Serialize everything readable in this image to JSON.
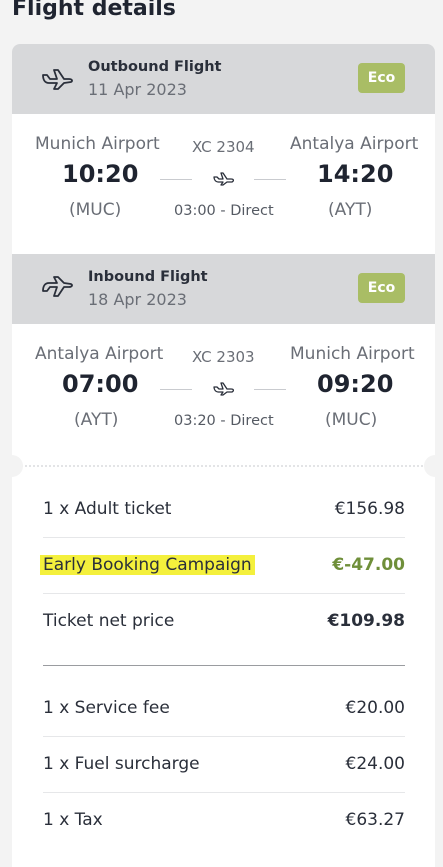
{
  "page_title": "Flight details",
  "outbound": {
    "title": "Outbound Flight",
    "date": "11 Apr 2023",
    "fare_class": "Eco",
    "from_airport": "Munich Airport",
    "to_airport": "Antalya Airport",
    "flight_number": "XC 2304",
    "departure_time": "10:20",
    "arrival_time": "14:20",
    "from_code": "(MUC)",
    "to_code": "(AYT)",
    "duration": "03:00 - Direct"
  },
  "inbound": {
    "title": "Inbound Flight",
    "date": "18 Apr 2023",
    "fare_class": "Eco",
    "from_airport": "Antalya Airport",
    "to_airport": "Munich Airport",
    "flight_number": "XC 2303",
    "departure_time": "07:00",
    "arrival_time": "09:20",
    "from_code": "(AYT)",
    "to_code": "(MUC)",
    "duration": "03:20 - Direct"
  },
  "prices": {
    "adult_ticket": {
      "label": "1 x Adult ticket",
      "amount": "€156.98"
    },
    "campaign": {
      "label": "Early Booking Campaign",
      "amount": "€-47.00"
    },
    "net": {
      "label": "Ticket net price",
      "amount": "€109.98"
    },
    "service_fee": {
      "label": "1 x Service fee",
      "amount": "€20.00"
    },
    "fuel": {
      "label": "1 x Fuel surcharge",
      "amount": "€24.00"
    },
    "tax": {
      "label": "1 x Tax",
      "amount": "€63.27"
    }
  },
  "icons": {
    "outbound": "plane-takeoff-icon",
    "inbound": "plane-landing-icon",
    "route": "plane-icon"
  },
  "colors": {
    "badge": "#a9bd65",
    "discount": "#6f8f3a",
    "highlight": "#f4f03c",
    "header_bg": "#d7d8da"
  }
}
